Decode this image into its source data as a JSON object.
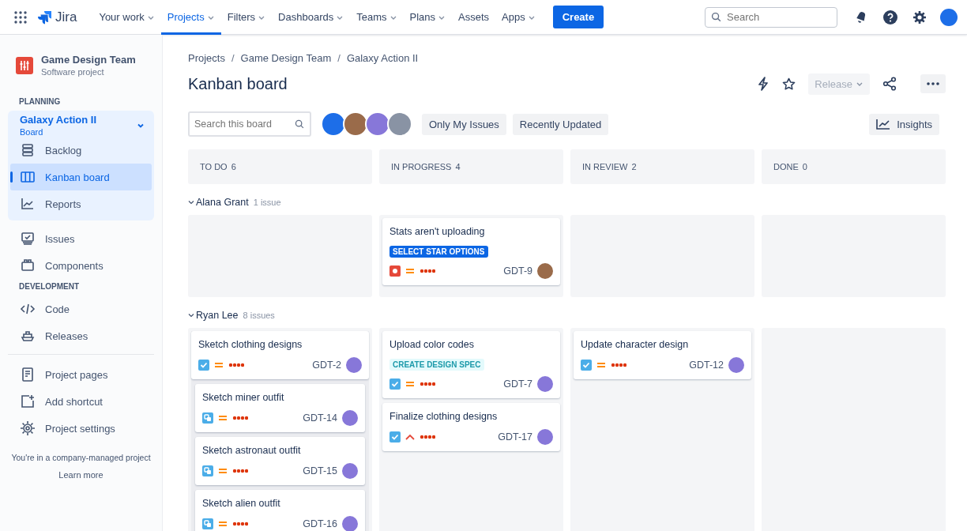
{
  "topnav": {
    "product": "Jira",
    "items": [
      {
        "label": "Your work",
        "dropdown": true,
        "selected": false
      },
      {
        "label": "Projects",
        "dropdown": true,
        "selected": true
      },
      {
        "label": "Filters",
        "dropdown": true,
        "selected": false
      },
      {
        "label": "Dashboards",
        "dropdown": true,
        "selected": false
      },
      {
        "label": "Teams",
        "dropdown": true,
        "selected": false
      },
      {
        "label": "Plans",
        "dropdown": true,
        "selected": false
      },
      {
        "label": "Assets",
        "dropdown": false,
        "selected": false
      },
      {
        "label": "Apps",
        "dropdown": true,
        "selected": false
      }
    ],
    "create": "Create",
    "search": {
      "placeholder": "Search"
    }
  },
  "sidebar": {
    "project": {
      "name": "Game Design Team",
      "type": "Software project"
    },
    "sections": [
      {
        "title": "PLANNING",
        "board": {
          "name": "Galaxy Action II",
          "sub": "Board",
          "expanded": true,
          "items": [
            {
              "label": "Backlog",
              "kind": "backlog",
              "selected": false
            },
            {
              "label": "Kanban board",
              "kind": "board",
              "selected": true
            },
            {
              "label": "Reports",
              "kind": "reports",
              "selected": false
            }
          ]
        },
        "items": [
          {
            "label": "Issues",
            "kind": "issues",
            "selected": false
          },
          {
            "label": "Components",
            "kind": "components",
            "selected": false
          }
        ]
      },
      {
        "title": "DEVELOPMENT",
        "items": [
          {
            "label": "Code",
            "kind": "code",
            "selected": false
          },
          {
            "label": "Releases",
            "kind": "releases",
            "selected": false
          }
        ]
      }
    ],
    "footer_items": [
      {
        "label": "Project pages",
        "kind": "pages",
        "selected": false
      },
      {
        "label": "Add shortcut",
        "kind": "shortcut",
        "selected": false
      },
      {
        "label": "Project settings",
        "kind": "settings",
        "selected": false
      }
    ],
    "note": "You're in a company-managed project",
    "link": "Learn more"
  },
  "breadcrumbs": {
    "separator": "/",
    "items": [
      "Projects",
      "Game Design Team",
      "Galaxy Action II"
    ]
  },
  "title": "Kanban board",
  "actions": {
    "release": {
      "label": "Release",
      "disabled": true
    }
  },
  "toolbar": {
    "search": {
      "placeholder": "Search this board"
    },
    "avatars": [
      {
        "color": "#1d6ee8"
      },
      {
        "color": "#9a6b4a"
      },
      {
        "color": "#8777d9"
      },
      {
        "color": "#8993a4"
      }
    ],
    "filters": [
      "Only My Issues",
      "Recently Updated"
    ],
    "insights": "Insights"
  },
  "columns": [
    {
      "name": "TO DO",
      "count": "6"
    },
    {
      "name": "IN PROGRESS",
      "count": "4"
    },
    {
      "name": "IN REVIEW",
      "count": "2"
    },
    {
      "name": "DONE",
      "count": "0"
    }
  ],
  "swimlanes": [
    {
      "name": "Alana Grant",
      "count": "1 issue",
      "expanded": true,
      "cells": [
        [],
        [
          {
            "title": "Stats aren't uploading",
            "label": {
              "text": "SELECT STAR OPTIONS",
              "kind": "epic-blue"
            },
            "kind": "bug",
            "priority": {
              "kind": "medium"
            },
            "key": "GDT-9",
            "assignee": {
              "color": "#9a6b4a"
            }
          }
        ],
        [],
        []
      ]
    },
    {
      "name": "Ryan Lee",
      "count": "8 issues",
      "expanded": true,
      "cells": [
        [
          {
            "title": "Sketch clothing designs",
            "kind": "task",
            "priority": {
              "kind": "medium"
            },
            "key": "GDT-2",
            "assignee": {
              "color": "#8777d9"
            },
            "children": [
              {
                "title": "Sketch miner outfit",
                "kind": "subtask",
                "priority": {
                  "kind": "medium"
                },
                "key": "GDT-14",
                "assignee": {
                  "color": "#8777d9"
                }
              },
              {
                "title": "Sketch astronaut outfit",
                "kind": "subtask",
                "priority": {
                  "kind": "medium"
                },
                "key": "GDT-15",
                "assignee": {
                  "color": "#8777d9"
                }
              },
              {
                "title": "Sketch alien outfit",
                "kind": "subtask",
                "priority": {
                  "kind": "medium"
                },
                "key": "GDT-16",
                "assignee": {
                  "color": "#8777d9"
                }
              }
            ]
          }
        ],
        [
          {
            "title": "Upload color codes",
            "label": {
              "text": "CREATE DESIGN SPEC",
              "kind": "epic-teal"
            },
            "kind": "task",
            "priority": {
              "kind": "medium"
            },
            "key": "GDT-7",
            "assignee": {
              "color": "#8777d9"
            }
          },
          {
            "title": "Finalize clothing designs",
            "kind": "task",
            "priority": {
              "kind": "high"
            },
            "key": "GDT-17",
            "assignee": {
              "color": "#8777d9"
            }
          }
        ],
        [
          {
            "title": "Update character design",
            "kind": "task",
            "priority": {
              "kind": "medium"
            },
            "key": "GDT-12",
            "assignee": {
              "color": "#8777d9"
            }
          }
        ],
        []
      ]
    }
  ]
}
